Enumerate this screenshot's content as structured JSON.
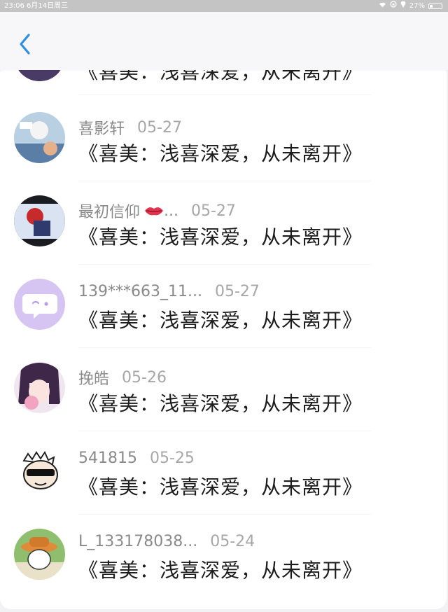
{
  "status_bar": {
    "time_date": "23:06   6月14日周三",
    "battery": "27%",
    "battery_level": 0.27
  },
  "nav": {
    "back_icon": "chevron-left-icon"
  },
  "comments": [
    {
      "name": "",
      "date": "",
      "text": "《喜美：浅喜深爱，从未离开》"
    },
    {
      "name": "喜影轩",
      "date": "05-27",
      "text": "《喜美：浅喜深爱，从未离开》"
    },
    {
      "name": "最初信仰",
      "name_suffix": "...",
      "date": "05-27",
      "text": "《喜美：浅喜深爱，从未离开》",
      "emoji": "lips-icon"
    },
    {
      "name": "139***663_11...",
      "date": "05-27",
      "text": "《喜美：浅喜深爱，从未离开》"
    },
    {
      "name": "挽皓",
      "date": "05-26",
      "text": "《喜美：浅喜深爱，从未离开》"
    },
    {
      "name": "541815",
      "date": "05-25",
      "text": "《喜美：浅喜深爱，从未离开》"
    },
    {
      "name": "L_133178038...",
      "date": "05-24",
      "text": "《喜美：浅喜深爱，从未离开》"
    }
  ],
  "colors": {
    "accent": "#2f8ee6",
    "name_text": "#8a8a8a",
    "comment_text": "#1c1c1c"
  }
}
